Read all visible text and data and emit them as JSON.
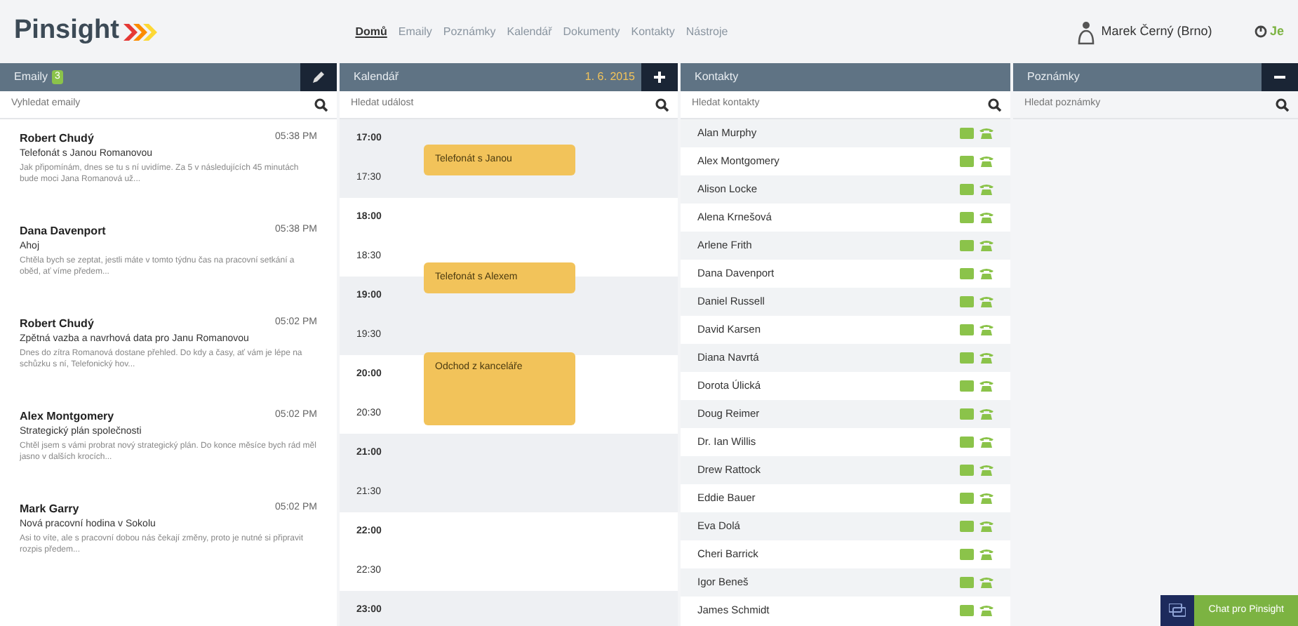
{
  "header": {
    "logo": "Pinsight",
    "nav": [
      {
        "label": "Domů",
        "selected": true
      },
      {
        "label": "Emaily",
        "selected": false
      },
      {
        "label": "Poznámky",
        "selected": false
      },
      {
        "label": "Kalendář",
        "selected": false
      },
      {
        "label": "Dokumenty",
        "selected": false
      },
      {
        "label": "Kontakty",
        "selected": false
      },
      {
        "label": "Nástroje",
        "selected": false
      }
    ],
    "user": "Marek Černý (Brno)",
    "status": "Je"
  },
  "emails": {
    "title": "Emaily",
    "badge": "3",
    "search": {
      "placeholder": "Vyhledat emaily"
    },
    "items": [
      {
        "sender": "Robert Chudý",
        "time": "05:38 PM",
        "subject": "Telefonát s Janou Romanovou",
        "preview": "Jak připomínám, dnes se tu s ní uvidíme. Za 5 v následujících 45 minutách bude moci Jana Romanová už..."
      },
      {
        "sender": "Dana Davenport",
        "time": "05:38 PM",
        "subject": "Ahoj",
        "preview": "Chtěla bych se zeptat, jestli máte v tomto týdnu čas na pracovní setkání a oběd, ať víme předem..."
      },
      {
        "sender": "Robert Chudý",
        "time": "05:02 PM",
        "subject": "Zpětná vazba a navrhová data pro Janu Romanovou",
        "preview": "Dnes do zítra Romanová dostane přehled. Do kdy a časy, ať vám je lépe na schůzku s ní, Telefonický hov..."
      },
      {
        "sender": "Alex Montgomery",
        "time": "05:02 PM",
        "subject": "Strategický plán společnosti",
        "preview": "Chtěl jsem s vámi probrat nový strategický plán. Do konce měsíce bych rád měl jasno v dalších krocích..."
      },
      {
        "sender": "Mark Garry",
        "time": "05:02 PM",
        "subject": "Nová pracovní hodina v Sokolu",
        "preview": "Asi to víte, ale s pracovní dobou nás čekají změny, proto je nutné si připravit rozpis předem..."
      }
    ]
  },
  "calendar": {
    "title": "Kalendář",
    "date": "1. 6. 2015",
    "search": {
      "placeholder": "Hledat událost"
    },
    "slots": [
      {
        "time": "17:00"
      },
      {
        "time": "17:30",
        "event": {
          "title": "Telefonát s Janou",
          "kind": "short"
        }
      },
      {
        "time": "18:00"
      },
      {
        "time": "18:30"
      },
      {
        "time": "19:00",
        "event": {
          "title": "Telefonát s Alexem",
          "kind": "short"
        }
      },
      {
        "time": "19:30"
      },
      {
        "time": "20:00",
        "event": {
          "title": "Odchod z kanceláře",
          "kind": "long"
        }
      },
      {
        "time": "20:30"
      },
      {
        "time": "21:00"
      },
      {
        "time": "21:30"
      },
      {
        "time": "22:00"
      },
      {
        "time": "22:30"
      },
      {
        "time": "23:00"
      }
    ]
  },
  "contacts": {
    "title": "Kontakty",
    "search": {
      "placeholder": "Hledat kontakty"
    },
    "items": [
      "Alan Murphy",
      "Alex Montgomery",
      "Alison Locke",
      "Alena Krnešová",
      "Arlene Frith",
      "Dana Davenport",
      "Daniel Russell",
      "David Karsen",
      "Diana Navrtá",
      "Dorota Úlická",
      "Doug Reimer",
      "Dr. Ian Willis",
      "Drew Rattock",
      "Eddie Bauer",
      "Eva Dolá",
      "Cheri Barrick",
      "Igor Beneš",
      "James Schmidt"
    ]
  },
  "notes": {
    "title": "Poznámky",
    "search": {
      "placeholder": "Hledat poznámky"
    }
  },
  "chat": {
    "label": "Chat pro Pinsight"
  }
}
